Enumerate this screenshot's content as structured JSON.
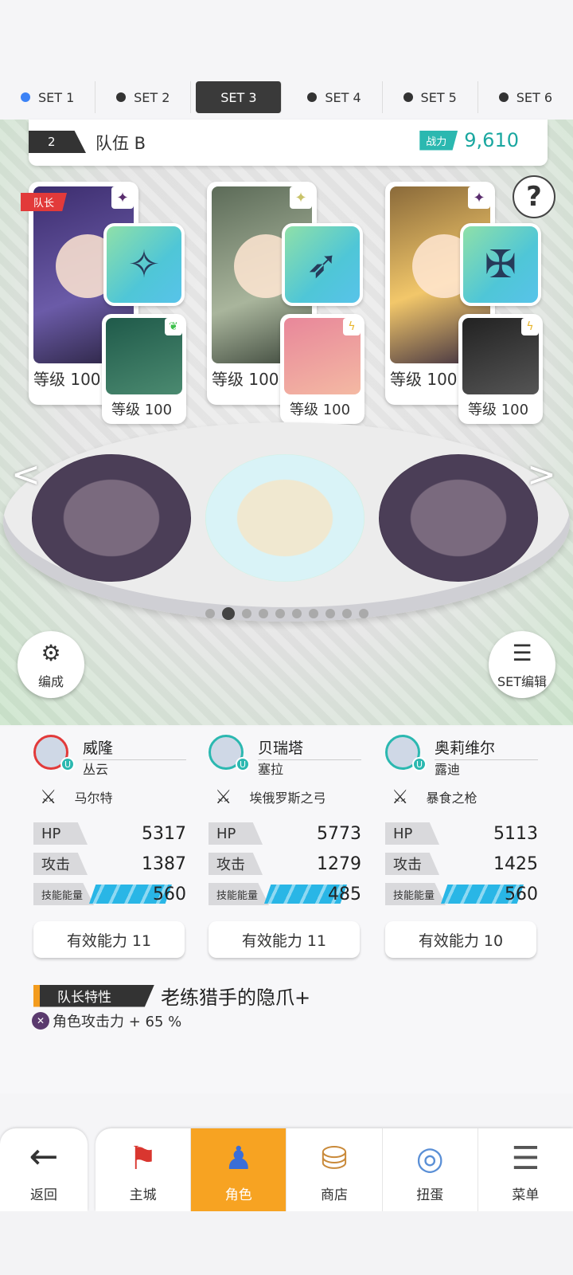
{
  "sets": [
    {
      "label": "SET 1"
    },
    {
      "label": "SET 2"
    },
    {
      "label": "SET 3"
    },
    {
      "label": "SET 4"
    },
    {
      "label": "SET 5"
    },
    {
      "label": "SET 6"
    }
  ],
  "team": {
    "number": "2",
    "name": "队伍 B",
    "combat_power_label": "战力",
    "combat_power": "9,610",
    "help": "?"
  },
  "slots": [
    {
      "leader_tag": "队长",
      "level_label": "等级 100",
      "sub_level_label": "等级 100",
      "main_color": "#3c2d6e",
      "weapon_icon": "staff-icon"
    },
    {
      "level_label": "等级 100",
      "sub_level_label": "等级 100",
      "main_color": "#5c6b58",
      "weapon_icon": "bow-icon"
    },
    {
      "level_label": "等级 100",
      "sub_level_label": "等级 100",
      "main_color": "#8a6a3a",
      "weapon_icon": "mace-icon"
    }
  ],
  "stage": {
    "pager_total": 10,
    "pager_active": 2
  },
  "buttons": {
    "formation": "编成",
    "set_edit": "SET编辑"
  },
  "heroes": [
    {
      "name": "威隆",
      "support": "丛云",
      "weapon": "马尔特",
      "hp_label": "HP",
      "hp": "5317",
      "atk_label": "攻击",
      "atk": "1387",
      "skill_label": "技能能量",
      "skill": "560",
      "effective": "有效能力 11"
    },
    {
      "name": "贝瑞塔",
      "support": "塞拉",
      "weapon": "埃俄罗斯之弓",
      "hp_label": "HP",
      "hp": "5773",
      "atk_label": "攻击",
      "atk": "1279",
      "skill_label": "技能能量",
      "skill": "485",
      "effective": "有效能力 11"
    },
    {
      "name": "奥莉维尔",
      "support": "露迪",
      "weapon": "暴食之枪",
      "hp_label": "HP",
      "hp": "5113",
      "atk_label": "攻击",
      "atk": "1425",
      "skill_label": "技能能量",
      "skill": "560",
      "effective": "有效能力 10"
    }
  ],
  "leader_skill": {
    "label": "队长特性",
    "name": "老练猎手的隐爪+",
    "desc": "角色攻击力 + 65 %"
  },
  "nav": {
    "back": "返回",
    "tabs": [
      {
        "label": "主城"
      },
      {
        "label": "角色"
      },
      {
        "label": "商店"
      },
      {
        "label": "扭蛋"
      },
      {
        "label": "菜单"
      }
    ]
  },
  "colors": {
    "accent": "#f7a322",
    "teal": "#2bb8b0",
    "leader": "#e23a3a",
    "skill_bar": "#29b6e6"
  }
}
